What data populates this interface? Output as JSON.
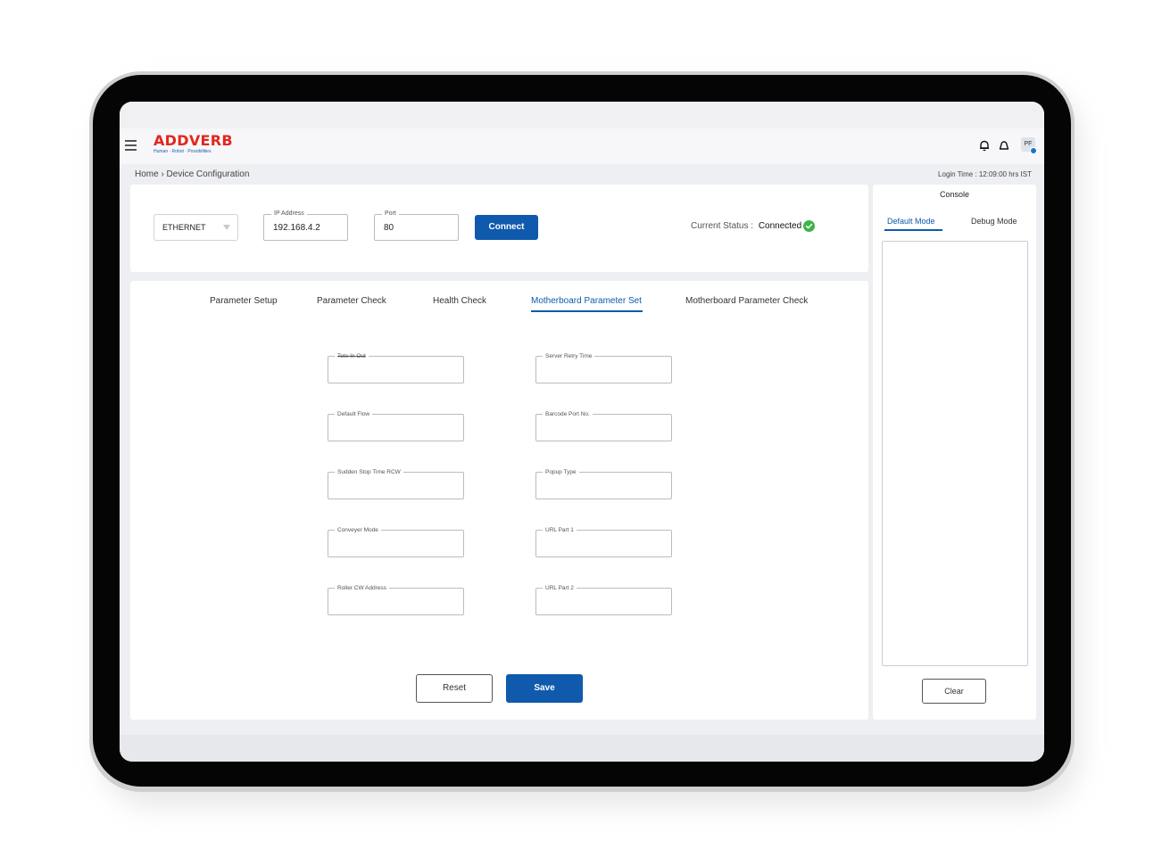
{
  "app": {
    "brand": "ADDVERB",
    "tagline": "Human · Robot · Possibilities",
    "avatar_initials": "PF"
  },
  "breadcrumb": "Home › Device Configuration",
  "login_time": "Login Time : 12:09:00 hrs IST",
  "connection": {
    "interface_value": "ETHERNET",
    "ip_label": "IP Address",
    "ip_value": "192.168.4.2",
    "port_label": "Port",
    "port_value": "80",
    "connect_label": "Connect",
    "status_label": "Current Status :",
    "status_value": "Connected"
  },
  "tabs": [
    {
      "label": "Parameter Setup"
    },
    {
      "label": "Parameter Check"
    },
    {
      "label": "Health Check"
    },
    {
      "label": "Motherboard Parameter Set",
      "active": true
    },
    {
      "label": "Motherboard Parameter Check"
    }
  ],
  "fields": {
    "left": [
      "Tote In Out",
      "Default Flow",
      "Sudden Stop Time RCW",
      "Conveyer Mode",
      "Roller CW Address"
    ],
    "right": [
      "Server Retry Time",
      "Barcode Port No.",
      "Popup Type",
      "URL Part 1",
      "URL Part 2"
    ]
  },
  "actions": {
    "reset_label": "Reset",
    "save_label": "Save"
  },
  "console": {
    "title": "Console",
    "tabs": [
      "Default Mode",
      "Debug Mode"
    ],
    "active_tab": "Default Mode",
    "clear_label": "Clear"
  },
  "colors": {
    "brand_red": "#e0281e",
    "accent_blue": "#0f5aac",
    "success_green": "#3bb54a"
  }
}
